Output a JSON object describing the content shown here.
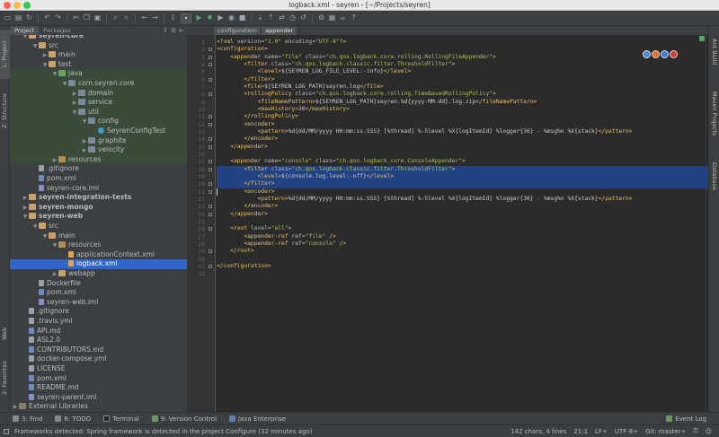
{
  "window": {
    "title": "logback.xml - seyren - [~/Projects/seyren]"
  },
  "left_strip": {
    "project": "1: Project",
    "structure": "Z: Structure",
    "web": "Web",
    "favorites": "2: Favorites"
  },
  "right_strip": {
    "ant": "Ant Build",
    "maven": "Maven Projects",
    "database": "Database"
  },
  "project_panel": {
    "tabs": [
      "Project",
      "Packages"
    ],
    "tree": [
      {
        "label": "seyren-core",
        "indent": 1,
        "arrow": "▼",
        "icon": "folder",
        "bold": true
      },
      {
        "label": "src",
        "indent": 2,
        "arrow": "▼",
        "icon": "folder"
      },
      {
        "label": "main",
        "indent": 3,
        "arrow": "▶",
        "icon": "folder"
      },
      {
        "label": "test",
        "indent": 3,
        "arrow": "▼",
        "icon": "folder"
      },
      {
        "label": "java",
        "indent": 4,
        "arrow": "▼",
        "icon": "folder-test",
        "hl": true
      },
      {
        "label": "com.seyren.core",
        "indent": 5,
        "arrow": "▼",
        "icon": "pkg",
        "hl": true
      },
      {
        "label": "domain",
        "indent": 6,
        "arrow": "▶",
        "icon": "pkg",
        "hl": true
      },
      {
        "label": "service",
        "indent": 6,
        "arrow": "▶",
        "icon": "pkg",
        "hl": true
      },
      {
        "label": "util",
        "indent": 6,
        "arrow": "▼",
        "icon": "pkg",
        "hl": true
      },
      {
        "label": "config",
        "indent": 7,
        "arrow": "▼",
        "icon": "pkg",
        "hl": true
      },
      {
        "label": "SeyrenConfigTest",
        "indent": 8,
        "arrow": "",
        "icon": "class",
        "hl": true
      },
      {
        "label": "graphite",
        "indent": 7,
        "arrow": "▶",
        "icon": "pkg",
        "hl": true
      },
      {
        "label": "velocity",
        "indent": 7,
        "arrow": "▶",
        "icon": "pkg",
        "hl": true
      },
      {
        "label": "resources",
        "indent": 4,
        "arrow": "▶",
        "icon": "folder-res",
        "hl": true
      },
      {
        "label": ".gitignore",
        "indent": 2,
        "arrow": "",
        "icon": "file"
      },
      {
        "label": "pom.xml",
        "indent": 2,
        "arrow": "",
        "icon": "md"
      },
      {
        "label": "seyren-core.iml",
        "indent": 2,
        "arrow": "",
        "icon": "iml"
      },
      {
        "label": "seyren-integration-tests",
        "indent": 1,
        "arrow": "▶",
        "icon": "folder",
        "bold": true
      },
      {
        "label": "seyren-mongo",
        "indent": 1,
        "arrow": "▶",
        "icon": "folder",
        "bold": true
      },
      {
        "label": "seyren-web",
        "indent": 1,
        "arrow": "▼",
        "icon": "folder",
        "bold": true
      },
      {
        "label": "src",
        "indent": 2,
        "arrow": "▼",
        "icon": "folder"
      },
      {
        "label": "main",
        "indent": 3,
        "arrow": "▼",
        "icon": "folder"
      },
      {
        "label": "resources",
        "indent": 4,
        "arrow": "▼",
        "icon": "folder-res"
      },
      {
        "label": "applicationContext.xml",
        "indent": 5,
        "arrow": "",
        "icon": "xml"
      },
      {
        "label": "logback.xml",
        "indent": 5,
        "arrow": "",
        "icon": "xml",
        "selected": true
      },
      {
        "label": "webapp",
        "indent": 4,
        "arrow": "▶",
        "icon": "folder"
      },
      {
        "label": "Dockerfile",
        "indent": 2,
        "arrow": "",
        "icon": "file"
      },
      {
        "label": "pom.xml",
        "indent": 2,
        "arrow": "",
        "icon": "md"
      },
      {
        "label": "seyren-web.iml",
        "indent": 2,
        "arrow": "",
        "icon": "iml"
      },
      {
        "label": ".gitignore",
        "indent": 1,
        "arrow": "",
        "icon": "file"
      },
      {
        "label": ".travis.yml",
        "indent": 1,
        "arrow": "",
        "icon": "file"
      },
      {
        "label": "API.md",
        "indent": 1,
        "arrow": "",
        "icon": "md"
      },
      {
        "label": "ASL2.0",
        "indent": 1,
        "arrow": "",
        "icon": "file"
      },
      {
        "label": "CONTRIBUTORS.md",
        "indent": 1,
        "arrow": "",
        "icon": "md"
      },
      {
        "label": "docker-compose.yml",
        "indent": 1,
        "arrow": "",
        "icon": "file"
      },
      {
        "label": "LICENSE",
        "indent": 1,
        "arrow": "",
        "icon": "file"
      },
      {
        "label": "pom.xml",
        "indent": 1,
        "arrow": "",
        "icon": "md"
      },
      {
        "label": "README.md",
        "indent": 1,
        "arrow": "",
        "icon": "md"
      },
      {
        "label": "seyren-parent.iml",
        "indent": 1,
        "arrow": "",
        "icon": "iml"
      },
      {
        "label": "External Libraries",
        "indent": 0,
        "arrow": "▶",
        "icon": "lib"
      }
    ]
  },
  "editor": {
    "breadcrumbs": [
      "configuration",
      "appender"
    ],
    "lines": [
      "<?xml version=\"1.0\" encoding=\"UTF-8\"?>",
      "<configuration>",
      "    <appender name=\"file\" class=\"ch.qos.logback.core.rolling.RollingFileAppender\">",
      "        <filter class=\"ch.qos.logback.classic.filter.ThresholdFilter\">",
      "            <level>${SEYREN_LOG_FILE_LEVEL:-info}</level>",
      "        </filter>",
      "        <file>${SEYREN_LOG_PATH}seyren.log</file>",
      "        <rollingPolicy class=\"ch.qos.logback.core.rolling.TimeBasedRollingPolicy\">",
      "            <fileNamePattern>${SEYREN_LOG_PATH}seyren.%d{yyyy-MM-dd}.log.zip</fileNamePattern>",
      "            <maxHistory>20</maxHistory>",
      "        </rollingPolicy>",
      "        <encoder>",
      "            <pattern>%d{dd/MM/yyyy HH:mm:ss.SSS} [%thread] %-5level %X{logItemId} %logger{36} - %msg%n %X{stack}</pattern>",
      "        </encoder>",
      "    </appender>",
      "",
      "    <appender name=\"console\" class=\"ch.qos.logback.core.ConsoleAppender\">",
      "        <filter class=\"ch.qos.logback.classic.filter.ThresholdFilter\">",
      "            <level>${console.log.level:-off}</level>",
      "        </filter>",
      "        <encoder>",
      "            <pattern>%d{dd/MM/yyyy HH:mm:ss.SSS} [%thread] %-5level %X{logItemId} %logger{36} - %msg%n %X{stack}</pattern>",
      "        </encoder>",
      "    </appender>",
      "",
      "    <root level=\"all\">",
      "        <appender-ref ref=\"file\" />",
      "        <appender-ref ref=\"console\" />",
      "    </root>",
      "",
      "</configuration>",
      ""
    ],
    "selected_lines": [
      18,
      19,
      20
    ]
  },
  "bottom_tools": {
    "find": "3: Find",
    "todo": "6: TODO",
    "terminal": "Terminal",
    "vcs": "9: Version Control",
    "java_ee": "Java Enterprise",
    "event_log": "Event Log"
  },
  "status": {
    "message": "Frameworks detected: Spring framework is detected in the project Configure (32 minutes ago)",
    "chars": "142 chars, 4 lines",
    "position": "21:1",
    "line_sep": "LF÷",
    "encoding": "UTF-8÷",
    "git": "Git: master÷"
  },
  "colors": {
    "selection": "#214283",
    "tree_selected": "#2f65ca",
    "test_highlight": "#3b4b3a"
  }
}
